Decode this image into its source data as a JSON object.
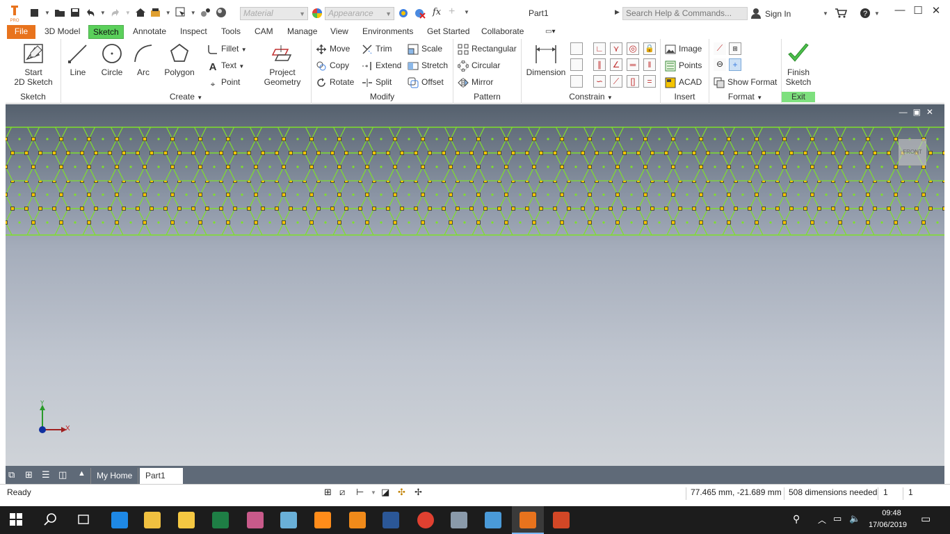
{
  "app": {
    "logo_text": "PRO",
    "document_title": "Part1",
    "material_placeholder": "Material",
    "appearance_placeholder": "Appearance",
    "search_placeholder": "Search Help & Commands...",
    "sign_in": "Sign In",
    "fx_symbol": "fx"
  },
  "menu": {
    "tabs": [
      "File",
      "3D Model",
      "Sketch",
      "Annotate",
      "Inspect",
      "Tools",
      "CAM",
      "Manage",
      "View",
      "Environments",
      "Get Started",
      "Collaborate"
    ],
    "active": "Sketch"
  },
  "ribbon": {
    "sketch_panel": {
      "label": "Sketch",
      "start_line1": "Start",
      "start_line2": "2D Sketch"
    },
    "create_panel": {
      "label": "Create",
      "line": "Line",
      "circle": "Circle",
      "arc": "Arc",
      "polygon": "Polygon",
      "fillet": "Fillet",
      "text": "Text",
      "point": "Point",
      "project_line1": "Project",
      "project_line2": "Geometry"
    },
    "modify_panel": {
      "label": "Modify",
      "move": "Move",
      "copy": "Copy",
      "rotate": "Rotate",
      "trim": "Trim",
      "extend": "Extend",
      "split": "Split",
      "scale": "Scale",
      "stretch": "Stretch",
      "offset": "Offset"
    },
    "pattern_panel": {
      "label": "Pattern",
      "rectangular": "Rectangular",
      "circular": "Circular",
      "mirror": "Mirror"
    },
    "constrain_panel": {
      "label": "Constrain",
      "dimension": "Dimension"
    },
    "insert_panel": {
      "label": "Insert",
      "image": "Image",
      "points": "Points",
      "acad": "ACAD"
    },
    "format_panel": {
      "label": "Format",
      "show_format": "Show Format"
    },
    "exit_panel": {
      "label": "Exit",
      "finish_line1": "Finish",
      "finish_line2": "Sketch"
    }
  },
  "viewport": {
    "viewcube_label": "FRONT",
    "axis_x": "X",
    "axis_y": "Y",
    "colors": {
      "sketch_line": "#7ee02a",
      "constraint_node": "#f5c400",
      "background_top": "#55606d",
      "background_bottom": "#cfd3d8"
    }
  },
  "doc_tabs": {
    "home": "My Home",
    "part": "Part1",
    "close": "✕"
  },
  "status": {
    "ready": "Ready",
    "coords": "77.465 mm, -21.689 mm",
    "dimensions_needed": "508 dimensions needed",
    "count1": "1",
    "count2": "1"
  },
  "taskbar": {
    "time": "09:48",
    "date": "17/06/2019"
  }
}
